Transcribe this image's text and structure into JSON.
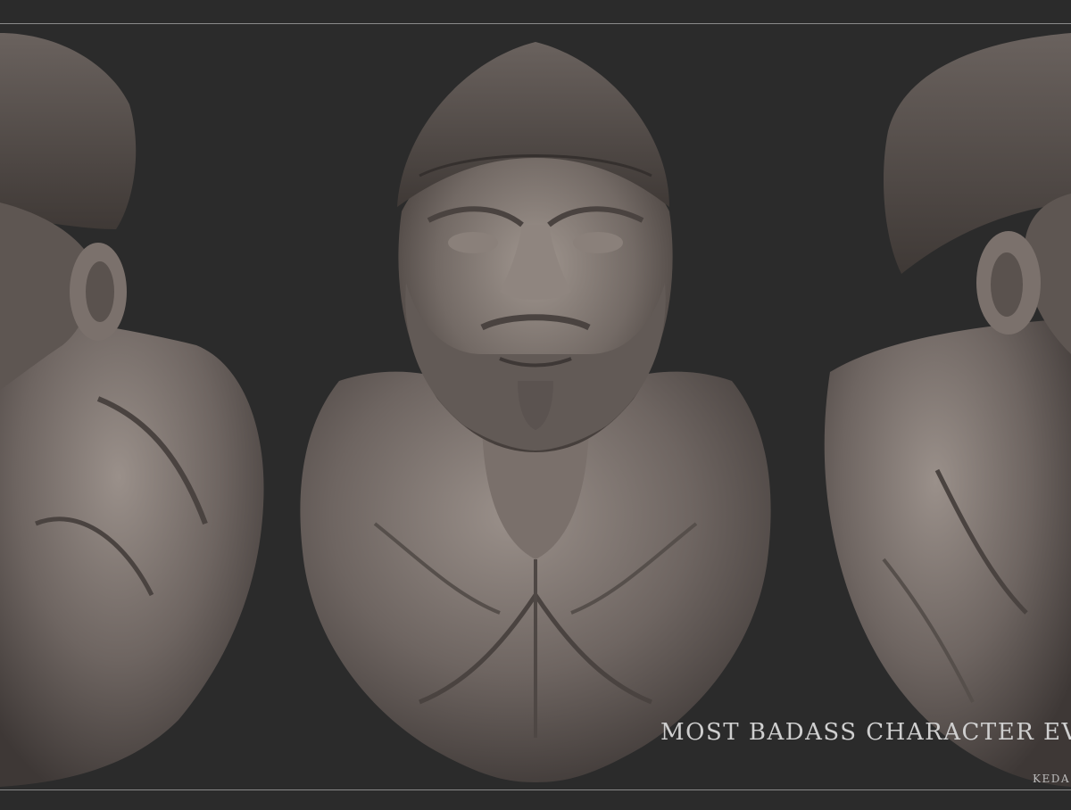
{
  "caption": "MOST BADASS CHARACTER EVER",
  "signature": "KEDA",
  "colors": {
    "background": "#2b2b2b",
    "clay": "#6e6561",
    "clay_highlight": "#9a908a",
    "clay_shadow": "#3e3836",
    "frame_line": "#8a8a8a",
    "caption_text": "#cfcfcf"
  }
}
